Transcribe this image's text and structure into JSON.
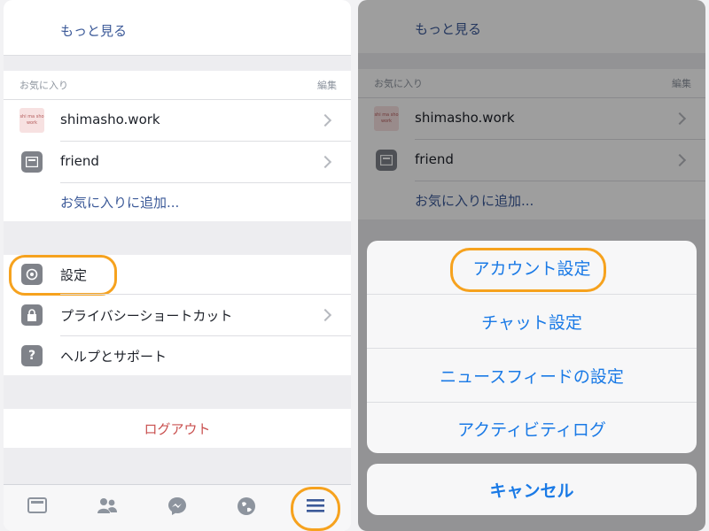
{
  "left": {
    "see_more": "もっと見る",
    "favorites_header": "お気に入り",
    "edit_label": "編集",
    "favorites": [
      {
        "label": "shimasho.work",
        "thumb_text": "shi ma sho work"
      },
      {
        "label": "friend"
      }
    ],
    "add_favorite": "お気に入りに追加...",
    "settings_items": [
      {
        "label": "設定"
      },
      {
        "label": "プライバシーショートカット"
      },
      {
        "label": "ヘルプとサポート"
      }
    ],
    "logout": "ログアウト"
  },
  "right": {
    "see_more": "もっと見る",
    "favorites_header": "お気に入り",
    "edit_label": "編集",
    "favorites": [
      {
        "label": "shimasho.work",
        "thumb_text": "shi ma sho work"
      },
      {
        "label": "friend"
      }
    ],
    "add_favorite": "お気に入りに追加...",
    "sheet": {
      "items": [
        {
          "label": "アカウント設定"
        },
        {
          "label": "チャット設定"
        },
        {
          "label": "ニュースフィードの設定"
        },
        {
          "label": "アクティビティログ"
        }
      ],
      "cancel": "キャンセル"
    }
  },
  "colors": {
    "highlight": "#f6a21e",
    "link": "#3b5998",
    "logout": "#c9504f",
    "sheet_text": "#1a7ae6"
  },
  "icons": [
    "gear-icon",
    "lock-icon",
    "help-icon",
    "newsfeed-icon",
    "friends-icon",
    "messenger-icon",
    "globe-icon",
    "menu-icon"
  ]
}
